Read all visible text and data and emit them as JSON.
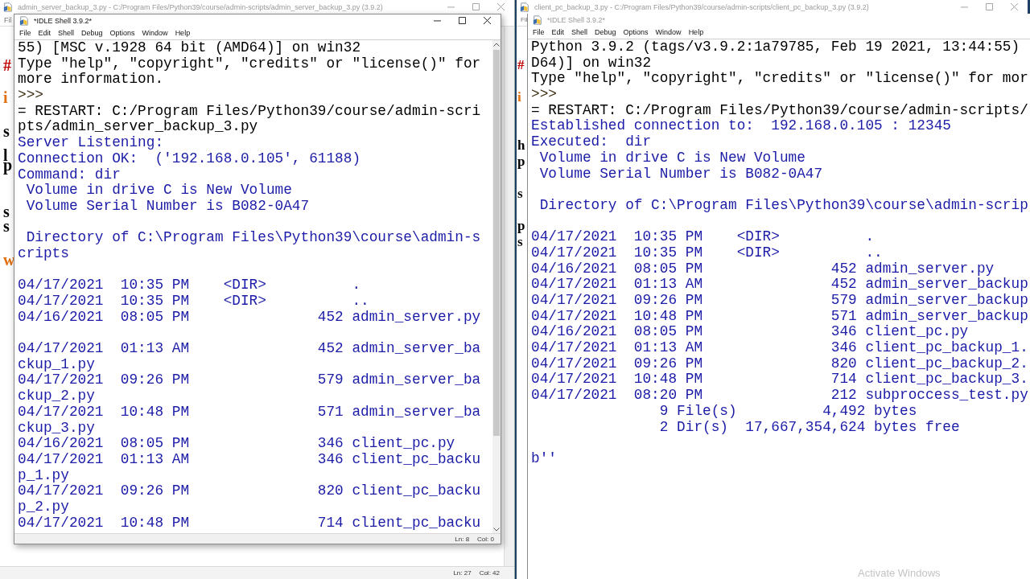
{
  "editors": [
    {
      "title": "admin_server_backup_3.py - C:/Program Files/Python39/course/admin-scripts/admin_server_backup_3.py (3.9.2)",
      "active": false,
      "menu": [
        "Fil"
      ],
      "gutter": [
        {
          "text": "#",
          "color": "#c00000"
        },
        {
          "text": "i",
          "color": "#e07010"
        },
        {
          "text": "s",
          "color": "#000000"
        },
        {
          "text": "l",
          "color": "#000000"
        },
        {
          "text": "p",
          "color": "#000000"
        },
        {
          "text": "s",
          "color": "#000000"
        },
        {
          "text": "s",
          "color": "#000000"
        },
        {
          "text": "w",
          "color": "#e07010"
        }
      ],
      "status": {
        "line": "Ln: 27",
        "col": "Col: 42"
      }
    },
    {
      "title": "client_pc_backup_3.py - C:/Program Files/Python39/course/admin-scripts/client_pc_backup_3.py (3.9.2)",
      "active": false,
      "menu": [
        "Fil"
      ],
      "gutter": [
        {
          "text": "#",
          "color": "#c00000"
        },
        {
          "text": "i",
          "color": "#e07010"
        },
        {
          "text": "h",
          "color": "#000000"
        },
        {
          "text": "p",
          "color": "#000000"
        },
        {
          "text": "s",
          "color": "#000000"
        },
        {
          "text": "p",
          "color": "#000000"
        },
        {
          "text": "s",
          "color": "#000000"
        }
      ]
    }
  ],
  "shells": [
    {
      "title": "*IDLE Shell 3.9.2*",
      "active": true,
      "menu": [
        "File",
        "Edit",
        "Shell",
        "Debug",
        "Options",
        "Window",
        "Help"
      ],
      "lines": [
        {
          "text": "55) [MSC v.1928 64 bit (AMD64)] on win32",
          "kind": "plain"
        },
        {
          "text": "Type \"help\", \"copyright\", \"credits\" or \"license()\" for",
          "kind": "plain"
        },
        {
          "text": "more information.",
          "kind": "plain"
        },
        {
          "text": ">>>",
          "kind": "prompt"
        },
        {
          "text": "= RESTART: C:/Program Files/Python39/course/admin-scri",
          "kind": "plain"
        },
        {
          "text": "pts/admin_server_backup_3.py",
          "kind": "plain"
        },
        {
          "text": "Server Listening:",
          "kind": "output"
        },
        {
          "text": "Connection OK:  ('192.168.0.105', 61188)",
          "kind": "output"
        },
        {
          "text": "Command: dir",
          "kind": "output"
        },
        {
          "text": " Volume in drive C is New Volume",
          "kind": "output"
        },
        {
          "text": " Volume Serial Number is B082-0A47",
          "kind": "output"
        },
        {
          "text": " Directory of C:\\Program Files\\Python39\\course\\admin-s",
          "kind": "output",
          "blank_before": true
        },
        {
          "text": "cripts",
          "kind": "output"
        },
        {
          "text": "04/17/2021  10:35 PM    <DIR>          .",
          "kind": "output",
          "blank_before": true
        },
        {
          "text": "04/17/2021  10:35 PM    <DIR>          ..",
          "kind": "output"
        },
        {
          "text": "04/16/2021  08:05 PM               452 admin_server.py",
          "kind": "output"
        },
        {
          "text": "04/17/2021  01:13 AM               452 admin_server_ba",
          "kind": "output",
          "blank_before": true
        },
        {
          "text": "ckup_1.py",
          "kind": "output"
        },
        {
          "text": "04/17/2021  09:26 PM               579 admin_server_ba",
          "kind": "output"
        },
        {
          "text": "ckup_2.py",
          "kind": "output"
        },
        {
          "text": "04/17/2021  10:48 PM               571 admin_server_ba",
          "kind": "output"
        },
        {
          "text": "ckup_3.py",
          "kind": "output"
        },
        {
          "text": "04/16/2021  08:05 PM               346 client_pc.py",
          "kind": "output"
        },
        {
          "text": "04/17/2021  01:13 AM               346 client_pc_backu",
          "kind": "output"
        },
        {
          "text": "p_1.py",
          "kind": "output"
        },
        {
          "text": "04/17/2021  09:26 PM               820 client_pc_backu",
          "kind": "output"
        },
        {
          "text": "p_2.py",
          "kind": "output"
        },
        {
          "text": "04/17/2021  10:48 PM               714 client_pc_backu",
          "kind": "output"
        }
      ],
      "status": {
        "line": "Ln: 8",
        "col": "Col: 0"
      }
    },
    {
      "title": "*IDLE Shell 3.9.2*",
      "active": false,
      "menu": [
        "File",
        "Edit",
        "Shell",
        "Debug",
        "Options",
        "Window",
        "Help"
      ],
      "lines": [
        {
          "text": "Python 3.9.2 (tags/v3.9.2:1a79785, Feb 19 2021, 13:44:55)",
          "kind": "plain"
        },
        {
          "text": "D64)] on win32",
          "kind": "plain"
        },
        {
          "text": "Type \"help\", \"copyright\", \"credits\" or \"license()\" for mor",
          "kind": "plain"
        },
        {
          "text": ">>>",
          "kind": "prompt"
        },
        {
          "text": "= RESTART: C:/Program Files/Python39/course/admin-scripts/",
          "kind": "plain"
        },
        {
          "text": "Established connection to:  192.168.0.105 : 12345",
          "kind": "output"
        },
        {
          "text": "Executed:  dir",
          "kind": "output"
        },
        {
          "text": " Volume in drive C is New Volume",
          "kind": "output"
        },
        {
          "text": " Volume Serial Number is B082-0A47",
          "kind": "output"
        },
        {
          "text": " Directory of C:\\Program Files\\Python39\\course\\admin-scrip",
          "kind": "output",
          "blank_before": true
        },
        {
          "text": "04/17/2021  10:35 PM    <DIR>          .",
          "kind": "output",
          "blank_before": true
        },
        {
          "text": "04/17/2021  10:35 PM    <DIR>          ..",
          "kind": "output"
        },
        {
          "text": "04/16/2021  08:05 PM               452 admin_server.py",
          "kind": "output"
        },
        {
          "text": "04/17/2021  01:13 AM               452 admin_server_backup",
          "kind": "output"
        },
        {
          "text": "04/17/2021  09:26 PM               579 admin_server_backup",
          "kind": "output"
        },
        {
          "text": "04/17/2021  10:48 PM               571 admin_server_backup",
          "kind": "output"
        },
        {
          "text": "04/16/2021  08:05 PM               346 client_pc.py",
          "kind": "output"
        },
        {
          "text": "04/17/2021  01:13 AM               346 client_pc_backup_1.",
          "kind": "output"
        },
        {
          "text": "04/17/2021  09:26 PM               820 client_pc_backup_2.",
          "kind": "output"
        },
        {
          "text": "04/17/2021  10:48 PM               714 client_pc_backup_3.",
          "kind": "output"
        },
        {
          "text": "04/17/2021  08:20 PM               212 subproccess_test.py",
          "kind": "output"
        },
        {
          "text": "               9 File(s)          4,492 bytes",
          "kind": "output"
        },
        {
          "text": "               2 Dir(s)  17,667,354,624 bytes free",
          "kind": "output"
        },
        {
          "text": "b''",
          "kind": "output",
          "blank_before": true
        }
      ]
    }
  ],
  "system_notice": "Activate Windows"
}
